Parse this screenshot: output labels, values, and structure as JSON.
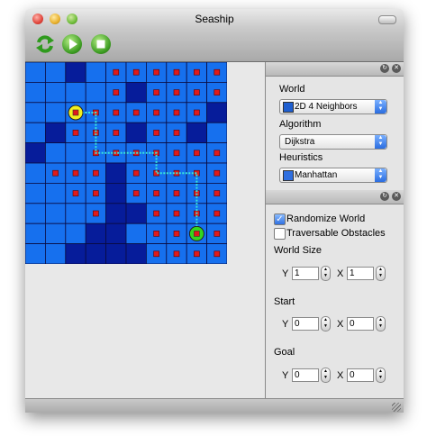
{
  "window": {
    "title": "Seaship"
  },
  "toolbar": {
    "reset_icon": "reset-arrows-icon",
    "play_icon": "play-icon",
    "stop_icon": "stop-icon"
  },
  "world": {
    "columns": 10,
    "rows": 10,
    "colors": {
      "open": "#1670ee",
      "obstacle": "#061c9a",
      "marker": "#e01a1a",
      "path": "#39e6d8",
      "start": "#f2ef1e",
      "goal": "#33d61e",
      "grid_line": "#0a0a40"
    },
    "obstacles": [
      [
        0,
        2
      ],
      [
        1,
        5
      ],
      [
        2,
        9
      ],
      [
        3,
        1
      ],
      [
        3,
        5
      ],
      [
        3,
        8
      ],
      [
        4,
        0
      ],
      [
        5,
        4
      ],
      [
        6,
        4
      ],
      [
        7,
        4
      ],
      [
        7,
        5
      ],
      [
        8,
        3
      ],
      [
        8,
        4
      ],
      [
        9,
        2
      ],
      [
        9,
        3
      ],
      [
        9,
        4
      ],
      [
        9,
        5
      ]
    ],
    "markers": [
      [
        0,
        4
      ],
      [
        0,
        5
      ],
      [
        0,
        6
      ],
      [
        0,
        7
      ],
      [
        0,
        8
      ],
      [
        0,
        9
      ],
      [
        1,
        4
      ],
      [
        1,
        6
      ],
      [
        1,
        7
      ],
      [
        1,
        8
      ],
      [
        1,
        9
      ],
      [
        2,
        3
      ],
      [
        2,
        4
      ],
      [
        2,
        5
      ],
      [
        2,
        6
      ],
      [
        2,
        7
      ],
      [
        2,
        8
      ],
      [
        3,
        2
      ],
      [
        3,
        3
      ],
      [
        3,
        4
      ],
      [
        3,
        6
      ],
      [
        3,
        7
      ],
      [
        4,
        3
      ],
      [
        4,
        4
      ],
      [
        4,
        5
      ],
      [
        4,
        6
      ],
      [
        4,
        7
      ],
      [
        4,
        8
      ],
      [
        4,
        9
      ],
      [
        5,
        1
      ],
      [
        5,
        2
      ],
      [
        5,
        3
      ],
      [
        5,
        5
      ],
      [
        5,
        6
      ],
      [
        5,
        7
      ],
      [
        5,
        8
      ],
      [
        5,
        9
      ],
      [
        6,
        2
      ],
      [
        6,
        3
      ],
      [
        6,
        5
      ],
      [
        6,
        6
      ],
      [
        6,
        7
      ],
      [
        6,
        8
      ],
      [
        6,
        9
      ],
      [
        7,
        3
      ],
      [
        7,
        6
      ],
      [
        7,
        7
      ],
      [
        7,
        8
      ],
      [
        7,
        9
      ],
      [
        8,
        6
      ],
      [
        8,
        7
      ],
      [
        8,
        9
      ],
      [
        9,
        6
      ],
      [
        9,
        7
      ],
      [
        9,
        8
      ],
      [
        9,
        9
      ]
    ],
    "path": [
      [
        2,
        2
      ],
      [
        2,
        3
      ],
      [
        3,
        3
      ],
      [
        4,
        3
      ],
      [
        4,
        4
      ],
      [
        4,
        5
      ],
      [
        4,
        6
      ],
      [
        5,
        6
      ],
      [
        5,
        7
      ],
      [
        5,
        8
      ],
      [
        6,
        8
      ],
      [
        7,
        8
      ],
      [
        8,
        8
      ]
    ],
    "start": [
      2,
      2
    ],
    "goal": [
      8,
      8
    ]
  },
  "panel1": {
    "world_label": "World",
    "world_value": "2D 4 Neighbors",
    "algorithm_label": "Algorithm",
    "algorithm_value": "Dijkstra",
    "heuristics_label": "Heuristics",
    "heuristics_value": "Manhattan"
  },
  "panel2": {
    "randomize_label": "Randomize World",
    "randomize_checked": true,
    "traversable_label": "Traversable Obstacles",
    "traversable_checked": false,
    "world_size_label": "World Size",
    "start_label": "Start",
    "goal_label": "Goal",
    "y_label": "Y",
    "x_label": "X",
    "world_size_y": "1",
    "world_size_x": "1",
    "start_y": "0",
    "start_x": "0",
    "goal_y": "0",
    "goal_x": "0"
  }
}
